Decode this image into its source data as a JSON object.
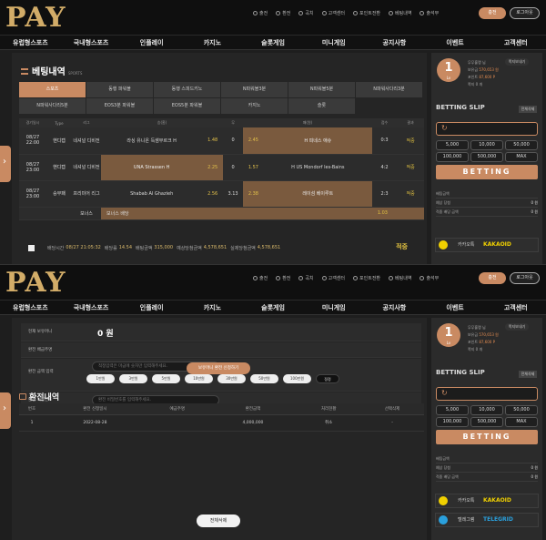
{
  "logo": "PAY",
  "top_links": [
    "출전",
    "환전",
    "곡치",
    "고객센터",
    "포인트전환",
    "베팅내역",
    "출석부"
  ],
  "btn_charge": "충전",
  "btn_logout": "로그아웃",
  "nav": [
    "유럽형스포츠",
    "국내형스포츠",
    "인플레이",
    "카지노",
    "슬롯게임",
    "미니게임",
    "공지사항",
    "이벤트",
    "고객센터"
  ],
  "s1": {
    "title": "베팅내역",
    "title_sub": "SPORTS",
    "tabs_row1": [
      "스포츠",
      "동행 파워볼",
      "동행 스피드키노",
      "N파워볼3분",
      "N파워볼5분",
      "N파워사다리3분"
    ],
    "tabs_row2": [
      "N파워사다리5분",
      "EOS3분 파워볼",
      "EOS5분 파워볼",
      "카지노",
      "슬롯"
    ],
    "cols": [
      "경기일시",
      "Type",
      "리그",
      "승(홈)",
      "무",
      "패(원)",
      "점수",
      "결과"
    ],
    "rows": [
      [
        "08/27 22:00",
        "핸디캡",
        "네셔널 디비전",
        "라싱 유니온 득샘부르크 H",
        "1.48",
        "0",
        "2.45",
        "H 피네스 애슈",
        "0:3",
        "적중"
      ],
      [
        "08/27 23:00",
        "핸디캡",
        "네셔널 디비전",
        "UNA Strassen H",
        "2.25",
        "0",
        "1.57",
        "H US Mondorf les-Bains",
        "4:2",
        "적중"
      ],
      [
        "08/27 23:00",
        "승무패",
        "프리미어 리그",
        "Shabab Al Ghazieh",
        "2.56",
        "3.13",
        "2.38",
        "레이섬 베이루트",
        "2:3",
        "적중"
      ]
    ],
    "bonus_label": "보너스",
    "bonus_text": "보너스 배당",
    "bonus_odd": "1.03",
    "sum": {
      "l1": "배당시간",
      "v1": "08/27 21:05:32",
      "l2": "배당률",
      "v2": "14.54",
      "l3": "배팅금액",
      "v3": "315,000",
      "l4": "예상당첨금액",
      "v4": "4,578,651",
      "l5": "실제당첨금액",
      "v5": "4,578,651",
      "hit": "적중"
    }
  },
  "side": {
    "level": "1",
    "level_sub": "Lv",
    "u1": "무무흘랭 님",
    "u2": "보유금",
    "u2v": "570,653 원",
    "u3": "포인트",
    "u3v": "87,600 P",
    "u4": "쪽지",
    "u4v": "0 개",
    "msg": "쪽지보내기",
    "slip_title": "BETTING SLIP",
    "slip_del": "전체삭제",
    "amounts": [
      "5,000",
      "10,000",
      "50,000",
      "100,000",
      "500,000",
      "MAX"
    ],
    "bet": "BETTING",
    "r1": "배팅금액",
    "r1v": "",
    "r2": "예상 당첨",
    "r2v": "0 원",
    "r3": "적중 배당 금액",
    "r3v": "0 원",
    "kakao_l": "카카오톡",
    "kakao": "KAKAOID",
    "tele_l": "텔레그램",
    "tele": "TELEGRID"
  },
  "s2": {
    "f1": "현재 보유머니",
    "f1v": "0 원",
    "f2": "환전 배금주명",
    "f3": "환전 금액 입력",
    "f3p": "적정입력은 마금에 숫자만 입력해주세요.",
    "chips": [
      "1만원",
      "3만원",
      "5만원",
      "10만원",
      "30만원",
      "50만원",
      "100만원",
      "정정"
    ],
    "f4": "환전 비밀번호",
    "f4p": "환전 비밀번호를 입력해주세요.",
    "apply": "보유머니 환전 신청하기",
    "hist": "환전내역",
    "hcols": [
      "번호",
      "환전 신청일시",
      "예금주명",
      "환전금액",
      "처리현황",
      "선택삭제"
    ],
    "hrow": [
      "1",
      "2022-08-28",
      "",
      "4,000,000",
      "취소",
      "-"
    ],
    "delall": "전체삭제"
  }
}
